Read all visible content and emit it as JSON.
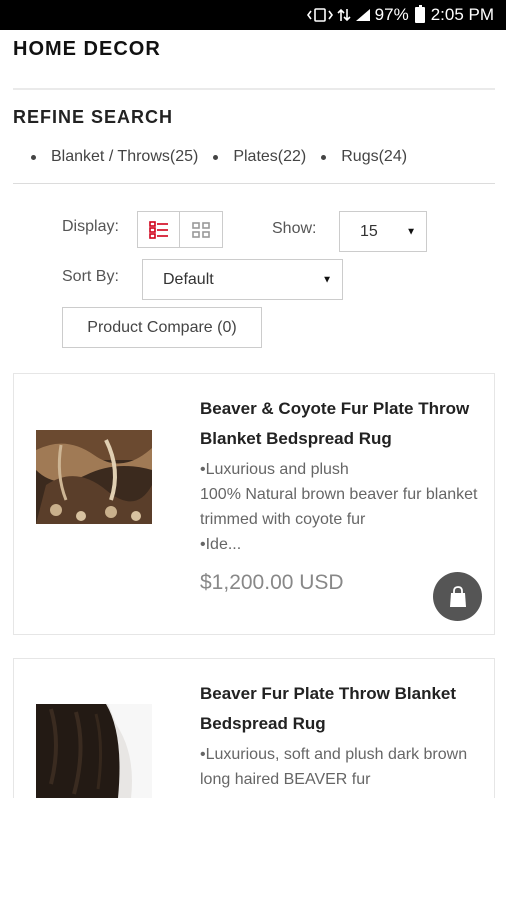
{
  "status_bar": {
    "battery": "97%",
    "time": "2:05 PM"
  },
  "page": {
    "title": "HOME DECOR"
  },
  "refine": {
    "title": "REFINE SEARCH",
    "items": [
      {
        "label": "Blanket / Throws(25)"
      },
      {
        "label": "Plates(22)"
      },
      {
        "label": "Rugs(24)"
      }
    ]
  },
  "toolbar": {
    "display_label": "Display:",
    "show_label": "Show:",
    "show_value": "15",
    "sort_label": "Sort By:",
    "sort_value": "Default",
    "compare_label": "Product Compare (0)",
    "accent_color": "#d0021b"
  },
  "products": [
    {
      "name": "Beaver & Coyote Fur Plate Throw Blanket Bedspread Rug",
      "description": "•Luxurious and plush\n100% Natural brown beaver fur blanket trimmed with coyote fur\n•Ide...",
      "price": "$1,200.00 USD"
    },
    {
      "name": "Beaver Fur Plate Throw Blanket Bedspread Rug",
      "description": "•Luxurious, soft and plush dark brown long haired BEAVER fur"
    }
  ]
}
